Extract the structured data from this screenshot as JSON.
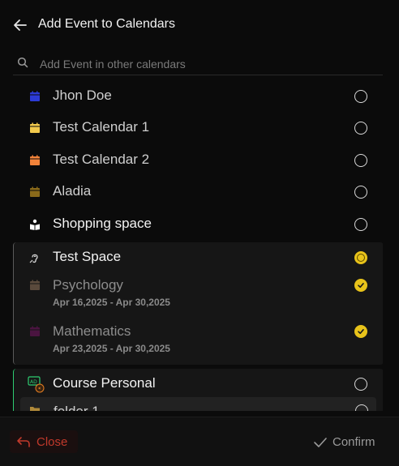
{
  "header": {
    "title": "Add Event to Calendars"
  },
  "search": {
    "placeholder": "Add Event in other calendars"
  },
  "calendars": [
    {
      "label": "Jhon Doe",
      "color": "#2c3bd6",
      "selected": false
    },
    {
      "label": "Test Calendar 1",
      "color": "#f2c94c",
      "selected": false
    },
    {
      "label": "Test Calendar 2",
      "color": "#f2833a",
      "selected": false
    },
    {
      "label": "Aladia",
      "color": "#8a6a1a",
      "selected": false
    },
    {
      "label": "Shopping space",
      "icon": "book-icon",
      "selected": false
    }
  ],
  "test_space": {
    "label": "Test Space",
    "icon": "hearing-icon",
    "selected": true,
    "children": [
      {
        "label": "Psychology",
        "dates": "Apr 16,2025 - Apr 30,2025",
        "color": "#5a4a3c",
        "checked": true
      },
      {
        "label": "Mathematics",
        "dates": "Apr 23,2025 - Apr 30,2025",
        "color": "#4a1440",
        "checked": true
      }
    ]
  },
  "course_personal": {
    "label": "Course Personal",
    "icon": "ad-icon",
    "selected": false,
    "children": [
      {
        "label": "folder 1",
        "icon": "folder-icon",
        "selected": false
      }
    ]
  },
  "footer": {
    "close_label": "Close",
    "confirm_label": "Confirm"
  },
  "colors": {
    "accent": "#e8c31a",
    "danger": "#c0392b",
    "green": "#2ecc71"
  }
}
